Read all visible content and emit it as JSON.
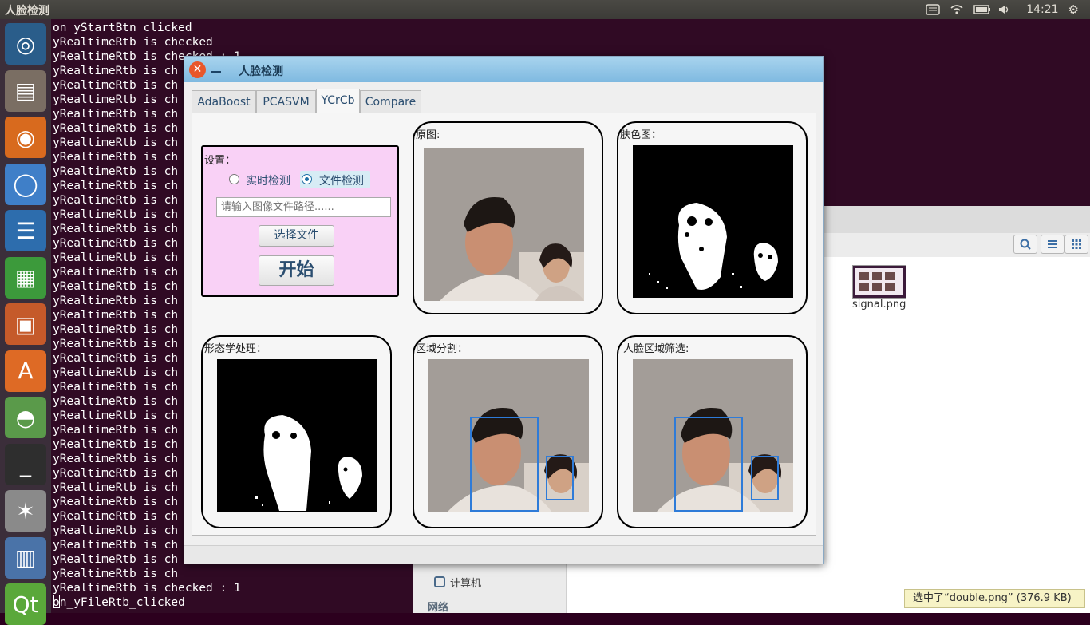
{
  "topbar": {
    "title": "人脸检测",
    "time": "14:21"
  },
  "launcher": {
    "items": [
      {
        "name": "ubuntu-dash",
        "glyph": "◎",
        "bg": "#2a5d8a"
      },
      {
        "name": "files",
        "glyph": "▤",
        "bg": "#7a6e63"
      },
      {
        "name": "firefox",
        "glyph": "◉",
        "bg": "#d86a1e"
      },
      {
        "name": "chromium",
        "glyph": "◯",
        "bg": "#3f7fc8"
      },
      {
        "name": "writer",
        "glyph": "☰",
        "bg": "#2d6dad"
      },
      {
        "name": "calc",
        "glyph": "▦",
        "bg": "#3c9a3b"
      },
      {
        "name": "impress",
        "glyph": "▣",
        "bg": "#c55a2a"
      },
      {
        "name": "software-center",
        "glyph": "A",
        "bg": "#de6a25"
      },
      {
        "name": "qt-app",
        "glyph": "◓",
        "bg": "#5a9a4a"
      },
      {
        "name": "terminal",
        "glyph": "_",
        "bg": "#2e2e2e"
      },
      {
        "name": "system-settings",
        "glyph": "✶",
        "bg": "#8a8a8a"
      },
      {
        "name": "workspace-switcher",
        "glyph": "▥",
        "bg": "#4a73a8"
      },
      {
        "name": "qt-creator",
        "glyph": "Qt",
        "bg": "#5aa83a"
      }
    ]
  },
  "terminal": {
    "lines": [
      "on_yStartBtn_clicked",
      "yRealtimeRtb is checked",
      "yRealtimeRtb is checked : 1",
      "yRealtimeRtb is ch",
      "yRealtimeRtb is ch",
      "yRealtimeRtb is ch",
      "yRealtimeRtb is ch",
      "yRealtimeRtb is ch",
      "yRealtimeRtb is ch",
      "yRealtimeRtb is ch",
      "yRealtimeRtb is ch",
      "yRealtimeRtb is ch",
      "yRealtimeRtb is ch",
      "yRealtimeRtb is ch",
      "yRealtimeRtb is ch",
      "yRealtimeRtb is ch",
      "yRealtimeRtb is ch",
      "yRealtimeRtb is ch",
      "yRealtimeRtb is ch",
      "yRealtimeRtb is ch",
      "yRealtimeRtb is ch",
      "yRealtimeRtb is ch",
      "yRealtimeRtb is ch",
      "yRealtimeRtb is ch",
      "yRealtimeRtb is ch",
      "yRealtimeRtb is ch",
      "yRealtimeRtb is ch",
      "yRealtimeRtb is ch",
      "yRealtimeRtb is ch",
      "yRealtimeRtb is ch",
      "yRealtimeRtb is ch",
      "yRealtimeRtb is ch",
      "yRealtimeRtb is ch",
      "yRealtimeRtb is ch",
      "yRealtimeRtb is ch",
      "yRealtimeRtb is ch",
      "yRealtimeRtb is ch",
      "yRealtimeRtb is ch",
      "yRealtimeRtb is ch",
      "yRealtimeRtb is checked : 1",
      "on_yFileRtb_clicked"
    ]
  },
  "files": {
    "sidebar": {
      "computer": "计算机",
      "network": "网络"
    },
    "thumb_label": "signal.png",
    "search_icon": "search-icon",
    "status": "选中了“double.png” (376.9 KB)"
  },
  "dialog": {
    "title": "人脸检测",
    "tabs": [
      "AdaBoost",
      "PCASVM",
      "YCrCb",
      "Compare"
    ],
    "active_tab": "YCrCb",
    "settings": {
      "label": "设置：",
      "radio_realtime": "实时检测",
      "radio_file": "文件检测",
      "path_placeholder": "请输入图像文件路径......",
      "choose_file": "选择文件",
      "start": "开始"
    },
    "panels": {
      "original": "原图:",
      "skin": "肤色图：",
      "morph": "形态学处理：",
      "region": "区域分割：",
      "face": "人脸区域筛选:"
    }
  }
}
